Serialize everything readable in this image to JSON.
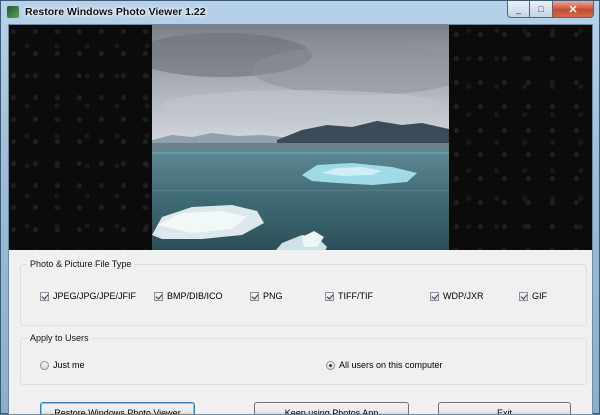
{
  "window": {
    "title": "Restore Windows Photo Viewer 1.22",
    "minimize_glyph": "_",
    "maximize_glyph": "□",
    "close_glyph": "✕"
  },
  "file_types": {
    "legend": "Photo & Picture File Type",
    "items": [
      {
        "label": "JPEG/JPG/JPE/JFIF",
        "checked": true
      },
      {
        "label": "BMP/DIB/ICO",
        "checked": true
      },
      {
        "label": "PNG",
        "checked": true
      },
      {
        "label": "TIFF/TIF",
        "checked": true
      },
      {
        "label": "WDP/JXR",
        "checked": true
      },
      {
        "label": "GIF",
        "checked": true
      }
    ]
  },
  "users": {
    "legend": "Apply to Users",
    "options": [
      {
        "label": "Just me",
        "selected": false
      },
      {
        "label": "All users on this computer",
        "selected": true
      }
    ]
  },
  "buttons": {
    "restore": "Restore Windows Photo Viewer",
    "keep": "Keep using Photos App",
    "exit": "Exit"
  },
  "icons": {
    "app": "photo-viewer-app-icon",
    "check": "checkmark-icon"
  }
}
